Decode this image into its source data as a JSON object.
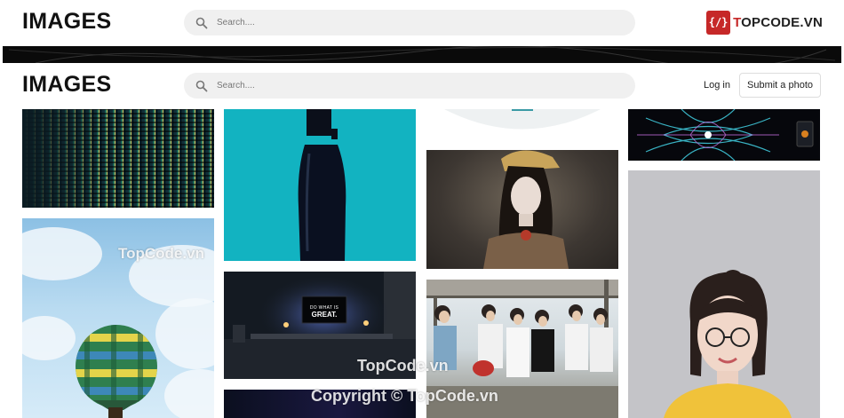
{
  "top_header": {
    "logo": "IMAGES",
    "search_placeholder": "Search....",
    "brand": {
      "mark": "{/}",
      "text_red": "T",
      "text_rest": "OPCODE.VN"
    }
  },
  "sticky_header": {
    "logo": "IMAGES",
    "search_placeholder": "Search....",
    "login_label": "Log in",
    "submit_label": "Submit a photo"
  },
  "desk_photo": {
    "screen_line1": "DO WHAT IS",
    "screen_line2": "GREAT."
  },
  "watermarks": {
    "balloon": "TopCode.vn",
    "middle": "TopCode.vn",
    "copyright": "Copyright © TopCode.vn"
  },
  "colors": {
    "brand_red": "#c62828",
    "search_bg": "#f0f0f0",
    "accent_cyan": "#12b3c1"
  },
  "icons": {
    "search": "search-icon",
    "brand": "brand-logo-icon"
  }
}
